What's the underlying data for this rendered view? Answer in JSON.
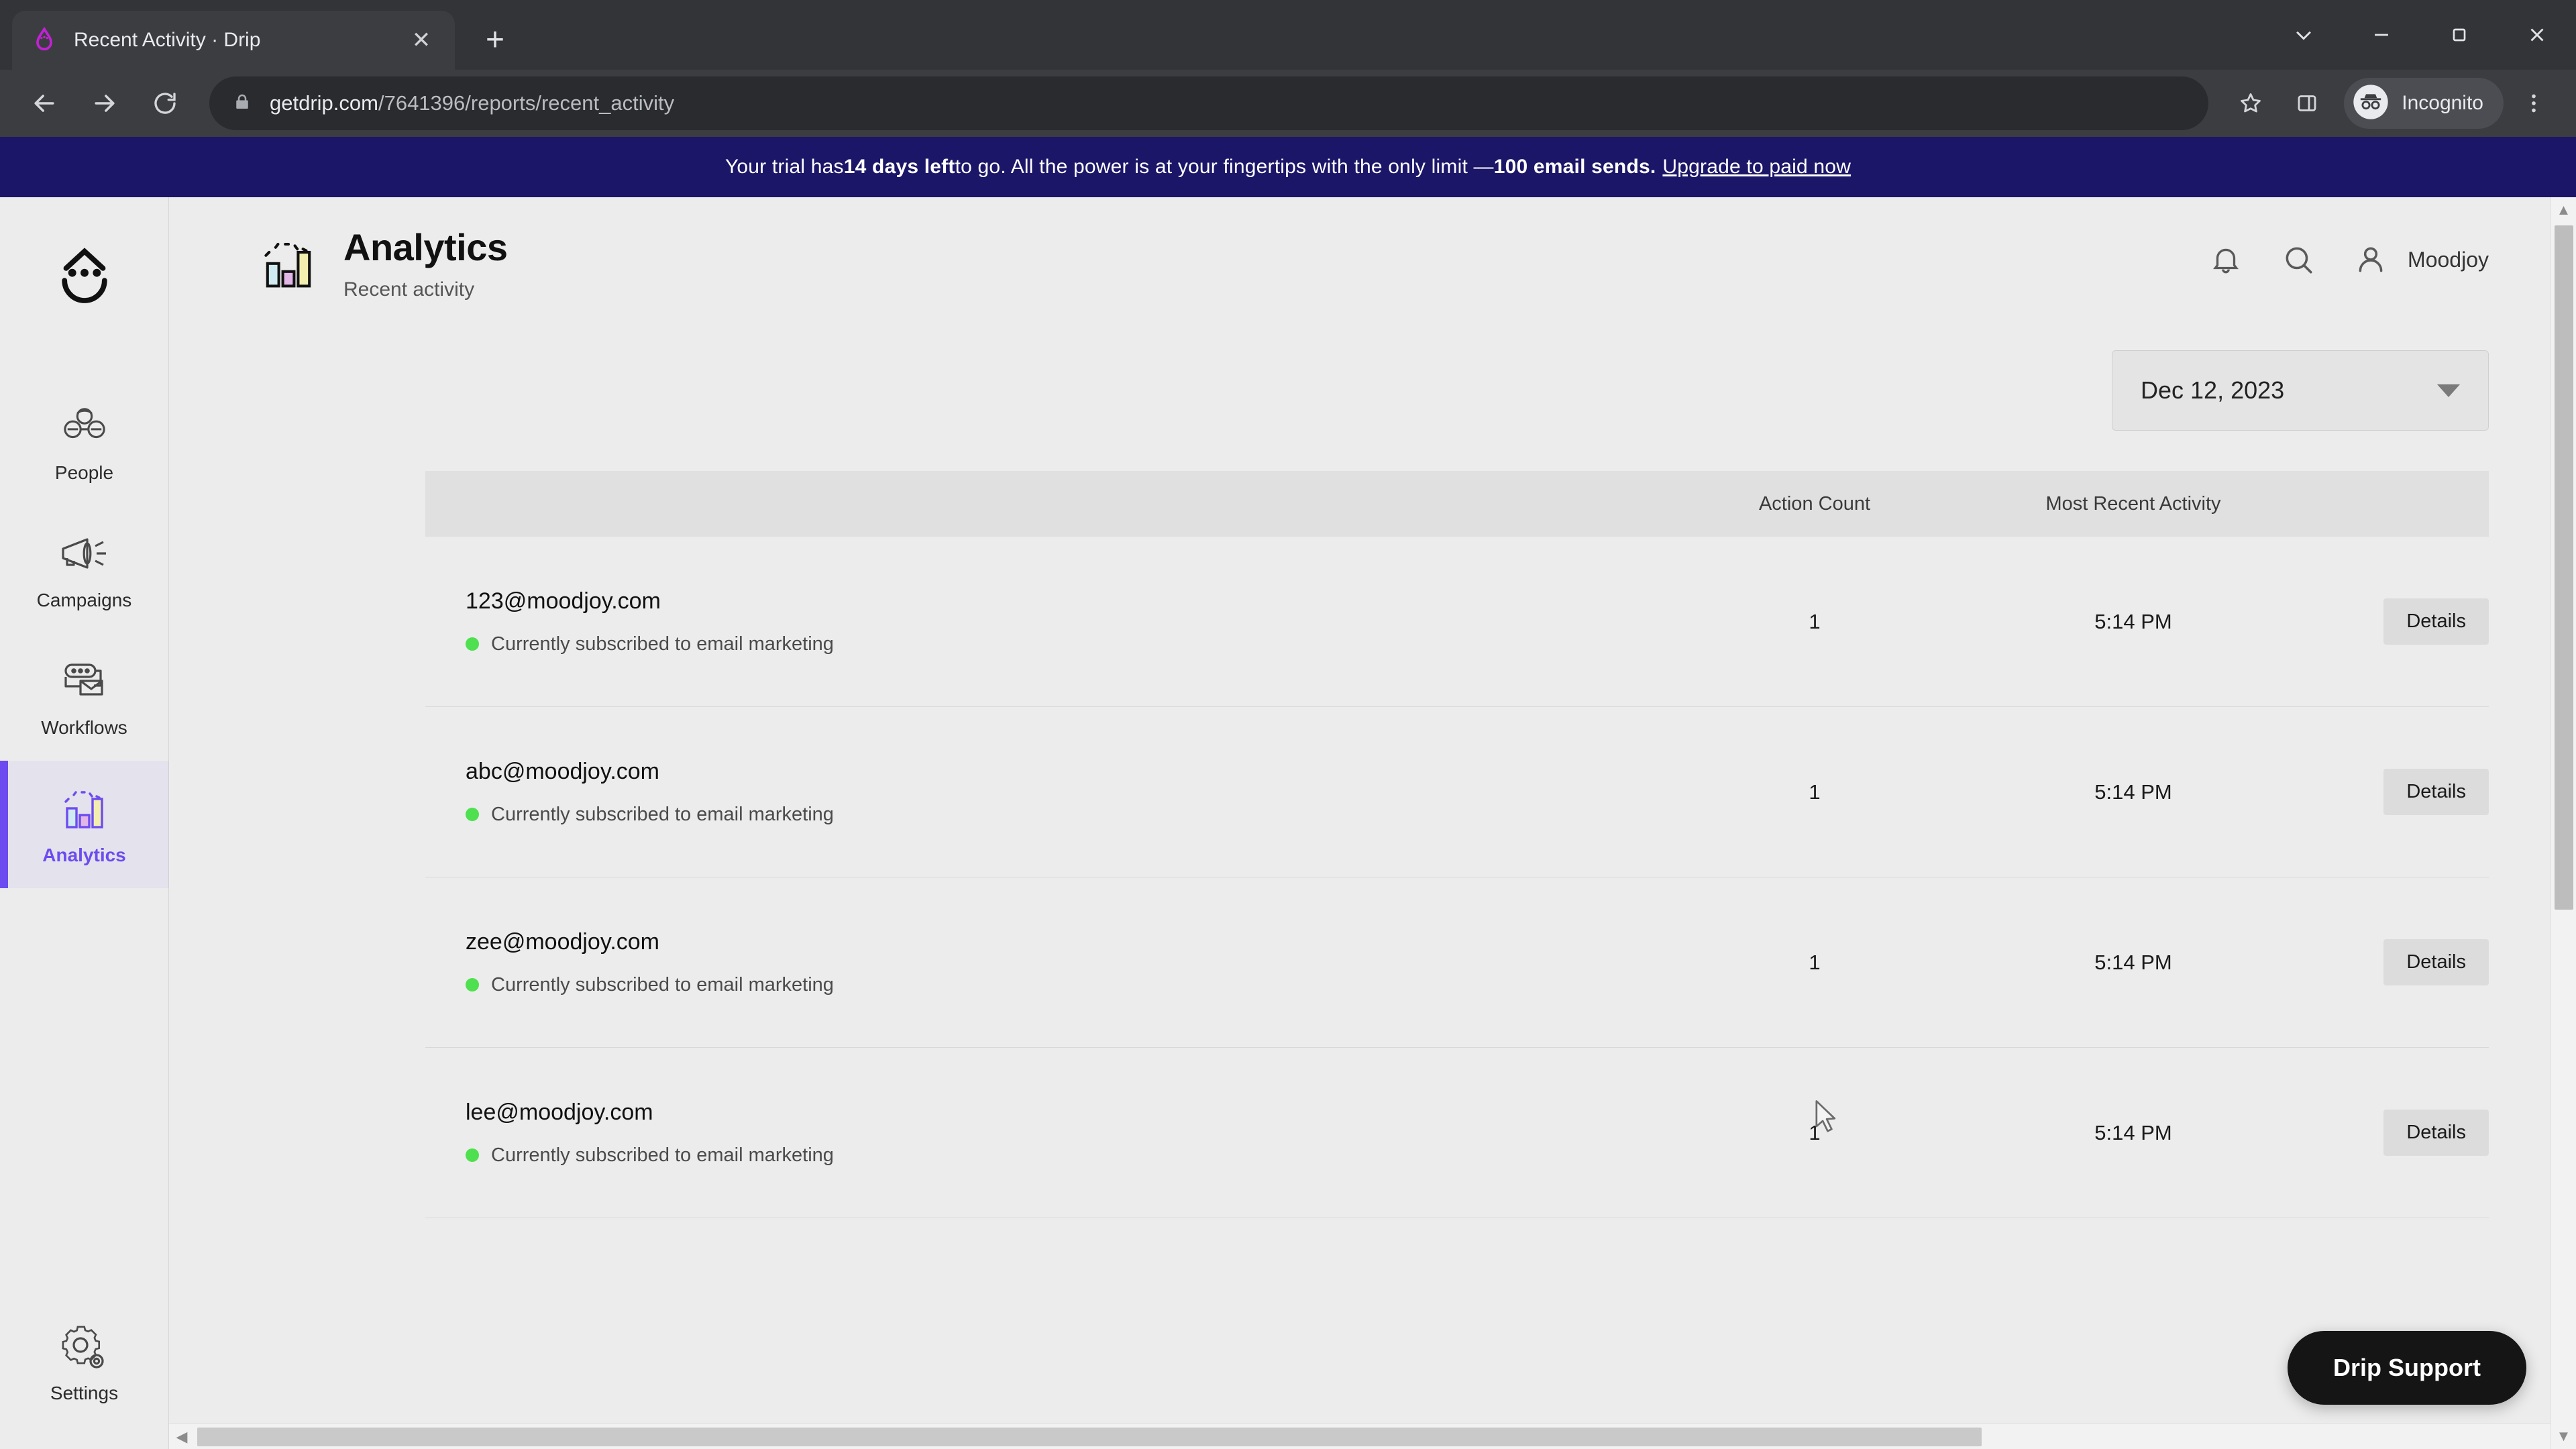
{
  "browser": {
    "tab": {
      "title": "Recent Activity · Drip",
      "favicon_icon": "drip-logo-icon",
      "close_icon": "close-icon"
    },
    "new_tab_icon": "plus-icon",
    "window_controls": [
      {
        "name": "minimize-dropdown",
        "icon": "chevron-down-icon"
      },
      {
        "name": "minimize",
        "icon": "minimize-icon"
      },
      {
        "name": "maximize",
        "icon": "restore-icon"
      },
      {
        "name": "close",
        "icon": "close-icon"
      }
    ],
    "nav": {
      "back_icon": "back-arrow-icon",
      "forward_icon": "forward-arrow-icon",
      "reload_icon": "reload-icon"
    },
    "omnibox": {
      "lock_icon": "lock-icon",
      "host": "getdrip.com",
      "path": "/7641396/reports/recent_activity"
    },
    "toolbar_icons": [
      {
        "name": "bookmark-star-icon",
        "glyph": "star"
      },
      {
        "name": "side-panel-icon",
        "glyph": "panel"
      }
    ],
    "profile": {
      "label": "Incognito",
      "icon": "incognito-icon"
    },
    "menu_icon": "kebab-menu-icon"
  },
  "banner": {
    "prefix": "Your trial has ",
    "days_left": "14 days left",
    "middle": " to go. All the power is at your fingertips with the only limit — ",
    "limit": "100 email sends.",
    "cta": "Upgrade to paid now",
    "background": "#1c1668"
  },
  "sidebar": {
    "logo_icon": "drip-smiley-logo-icon",
    "accent": "#6c4cf0",
    "items": [
      {
        "label": "People",
        "icon": "people-icon",
        "active": false
      },
      {
        "label": "Campaigns",
        "icon": "megaphone-icon",
        "active": false
      },
      {
        "label": "Workflows",
        "icon": "workflow-icon",
        "active": false
      },
      {
        "label": "Analytics",
        "icon": "bar-chart-icon",
        "active": true
      }
    ],
    "bottom_item": {
      "label": "Settings",
      "icon": "gear-icon"
    }
  },
  "header": {
    "icon": "bar-chart-icon",
    "title": "Analytics",
    "subtitle": "Recent activity",
    "notifications_icon": "bell-icon",
    "search_icon": "search-icon",
    "account_icon": "user-icon",
    "account_name": "Moodjoy"
  },
  "date_picker": {
    "value": "Dec 12, 2023",
    "caret_icon": "chevron-down-icon"
  },
  "table": {
    "columns": {
      "name": "",
      "action_count": "Action Count",
      "most_recent_activity": "Most Recent Activity",
      "actions": ""
    },
    "action_label": "Details",
    "status_color": "#4ee04e",
    "rows": [
      {
        "email": "123@moodjoy.com",
        "status": "Currently subscribed to email marketing",
        "action_count": "1",
        "most_recent_activity": "5:14 PM",
        "details": "Details"
      },
      {
        "email": "abc@moodjoy.com",
        "status": "Currently subscribed to email marketing",
        "action_count": "1",
        "most_recent_activity": "5:14 PM",
        "details": "Details"
      },
      {
        "email": "zee@moodjoy.com",
        "status": "Currently subscribed to email marketing",
        "action_count": "1",
        "most_recent_activity": "5:14 PM",
        "details": "Details"
      },
      {
        "email": "lee@moodjoy.com",
        "status": "Currently subscribed to email marketing",
        "action_count": "1",
        "most_recent_activity": "5:14 PM",
        "details": "Details"
      }
    ]
  },
  "support_widget": {
    "label": "Drip Support"
  },
  "scrollbars": {
    "vertical": {
      "up_icon": "scroll-up-arrow-icon",
      "down_icon": "scroll-down-arrow-icon"
    },
    "horizontal": {
      "left_icon": "scroll-left-arrow-icon"
    }
  }
}
